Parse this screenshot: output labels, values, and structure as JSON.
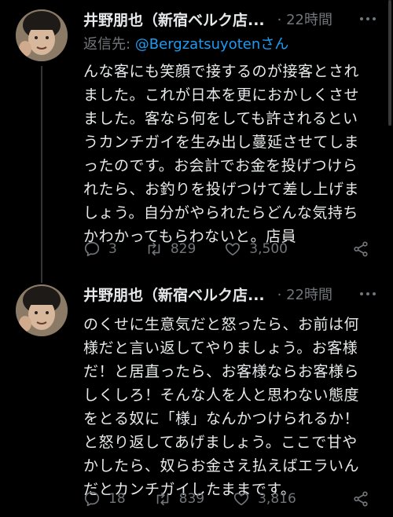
{
  "tweets": [
    {
      "author": "井野朋也（新宿ベルク店...",
      "time": "· 22時間",
      "reply_prefix": "返信先: ",
      "reply_handle": "@Bergzatsuyoten",
      "reply_suffix": "さん",
      "text": "んな客にも笑顔で接するのが接客とされ\nました。これが日本を更におかしくさせ\nました。客なら何をしても許されるとい\nうカンチガイを生み出し蔓延させてしま\nったのです。お会計でお金を投げつけら\nれたら、お釣りを投げつけて差し上げま\nしょう。自分がやられたらどんな気持ち\nかわかってもらわないと。店員",
      "replies": "3",
      "retweets": "829",
      "likes": "3,500"
    },
    {
      "author": "井野朋也（新宿ベルク店...",
      "time": "· 22時間",
      "text": "のくせに生意気だと怒ったら、お前は何\n様だと言い返してやりましょう。お客様\nだ！と居直ったら、お客様ならお客様ら\nしくしろ！そんな人を人と思わない態度\nをとる奴に「様」なんかつけられるか！\nと怒り返してあげましょう。ここで甘や\nかしたら、奴らお金さえ払えばエラいん\nだとカンチガイしたままです。",
      "replies": "18",
      "retweets": "839",
      "likes": "3,816"
    }
  ],
  "icons": {
    "reply": "reply-icon",
    "retweet": "retweet-icon",
    "like": "heart-icon",
    "share": "share-icon",
    "more": "more-icon"
  },
  "colors": {
    "background": "#000000",
    "text": "#e7e9ea",
    "secondary": "#71767b",
    "link": "#1d9bf0"
  }
}
